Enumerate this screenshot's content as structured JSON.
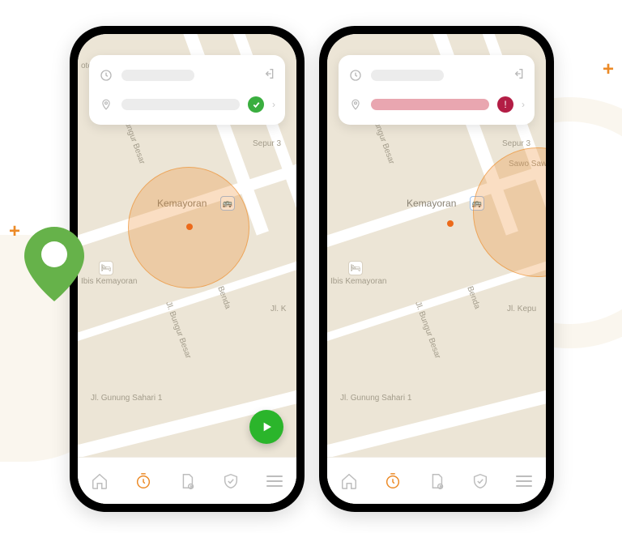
{
  "map": {
    "area_label": "Kemayoran",
    "poi_hotel": "Ibis Kemayoran",
    "streets": {
      "bungur_besar": "Jl. Bungur Besar",
      "gunung_sahari": "Jl. Gunung Sahari 1",
      "sepur": "Sepur 3",
      "kepu": "Jl. Kepu",
      "benda": "Benda",
      "sawo": "Sawo Sawo",
      "jlk": "Jl. K",
      "otel": "otel"
    }
  },
  "phone_a": {
    "status_row1": {
      "placeholder": ""
    },
    "status_row2": {
      "placeholder": "",
      "state": "ok"
    },
    "geofence": {
      "user_inside": true
    }
  },
  "phone_b": {
    "status_row1": {
      "placeholder": ""
    },
    "status_row2": {
      "placeholder": "",
      "state": "error"
    },
    "geofence": {
      "user_inside": false
    }
  },
  "nav": {
    "items": [
      "home",
      "timer",
      "notes",
      "shield",
      "menu"
    ],
    "active": "timer"
  },
  "colors": {
    "accent": "#ec8a26",
    "ok": "#3aae3f",
    "error": "#b31d45",
    "play": "#2bb52b"
  }
}
